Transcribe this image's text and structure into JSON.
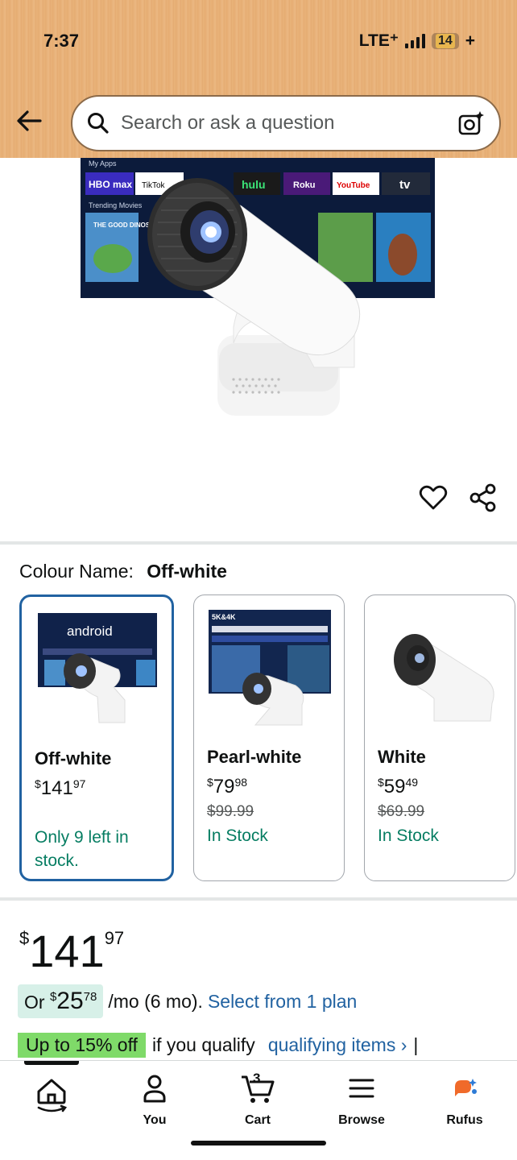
{
  "status_bar": {
    "time": "7:37",
    "network": "LTE⁺",
    "battery": "14",
    "battery_suffix": "+"
  },
  "search": {
    "placeholder": "Search or ask a question"
  },
  "hero": {
    "tv_apps": [
      "HBO max",
      "TikTok",
      "hulu",
      "Roku",
      "YouTube",
      "tv"
    ],
    "tv_section_top": "My Apps",
    "tv_section_movies": "Trending Movies",
    "movie_title": "THE GOOD DINOSAUR",
    "carousel_count": 5,
    "carousel_active": 0
  },
  "colour": {
    "label": "Colour Name:",
    "selected": "Off-white"
  },
  "swatches": [
    {
      "name": "Off-white",
      "currency": "$",
      "price_whole": "141",
      "price_frac": "97",
      "was": "",
      "stock": "Only 9 left in stock.",
      "thumb_text": "android"
    },
    {
      "name": "Pearl-white",
      "currency": "$",
      "price_whole": "79",
      "price_frac": "98",
      "was": "$99.99",
      "stock": "In Stock",
      "thumb_text": "5K&4K"
    },
    {
      "name": "White",
      "currency": "$",
      "price_whole": "59",
      "price_frac": "49",
      "was": "$69.99",
      "stock": "In Stock",
      "thumb_text": ""
    }
  ],
  "price": {
    "currency": "$",
    "whole": "141",
    "frac": "97"
  },
  "monthly": {
    "prefix": "Or",
    "currency": "$",
    "whole": "25",
    "frac": "78",
    "suffix": "/mo (6 mo).",
    "link": "Select from 1 plan"
  },
  "promo": {
    "badge": "Up to 15% off",
    "text": "if you qualify",
    "link": "qualifying items ›",
    "sep": "|"
  },
  "nav": [
    {
      "label": "",
      "icon": "home-icon"
    },
    {
      "label": "You",
      "icon": "user-icon"
    },
    {
      "label": "Cart",
      "icon": "cart-icon",
      "count": "3"
    },
    {
      "label": "Browse",
      "icon": "menu-icon"
    },
    {
      "label": "Rufus",
      "icon": "rufus-icon"
    }
  ],
  "colors": {
    "accent": "#2162a1",
    "stock": "#067d62",
    "promo_badge": "#7fda69",
    "header": "#e9b37a"
  }
}
